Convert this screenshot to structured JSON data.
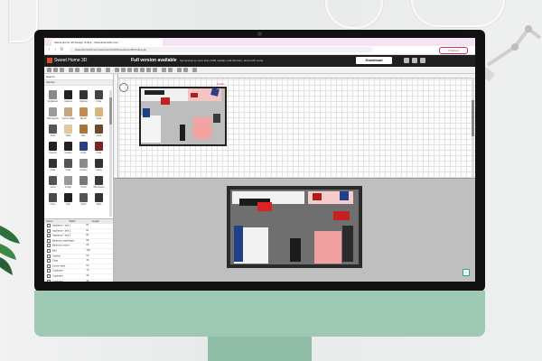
{
  "browser": {
    "tab_title": "Sweet Home 3D Design Online - SweetHome3D.com",
    "url": "sweethome3d.com/sweethome3d/SweetHome3DOnline.jsp",
    "profile_label": "Finished"
  },
  "app": {
    "name": "Sweet Home 3D",
    "banner_title": "Full version available",
    "banner_text": "Get access to more than 1400 models, edit furniture, and much more!",
    "download_label": "Download"
  },
  "catalog": {
    "search_label": "Search",
    "category": "Kitchen",
    "items": [
      {
        "label": "Appliance",
        "color": "#8a8a8a"
      },
      {
        "label": "Cabinet",
        "color": "#222222"
      },
      {
        "label": "Cabinet",
        "color": "#333333"
      },
      {
        "label": "Chair",
        "color": "#444444"
      },
      {
        "label": "Dishwasher",
        "color": "#9b9b9b"
      },
      {
        "label": "Corner table",
        "color": "#c9a77a"
      },
      {
        "label": "Bench",
        "color": "#c38b4f"
      },
      {
        "label": "Desk",
        "color": "#d9b57e"
      },
      {
        "label": "Shelf",
        "color": "#555555"
      },
      {
        "label": "Table",
        "color": "#e0c89a"
      },
      {
        "label": "Box",
        "color": "#a9743a"
      },
      {
        "label": "Desk",
        "color": "#6b4a2c"
      },
      {
        "label": "Counter",
        "color": "#222222"
      },
      {
        "label": "Cooker",
        "color": "#222222"
      },
      {
        "label": "Chair",
        "color": "#2b3e83"
      },
      {
        "label": "Chair",
        "color": "#7a2323"
      },
      {
        "label": "Chair",
        "color": "#333333"
      },
      {
        "label": "Chair",
        "color": "#555555"
      },
      {
        "label": "Cooker",
        "color": "#8a8a8a"
      },
      {
        "label": "Lamp",
        "color": "#333333"
      },
      {
        "label": "Lamp",
        "color": "#555555"
      },
      {
        "label": "Fridge",
        "color": "#999999"
      },
      {
        "label": "Hood",
        "color": "#777777"
      },
      {
        "label": "Microwave",
        "color": "#3a3a3a"
      },
      {
        "label": "Oven",
        "color": "#4a4a4a"
      },
      {
        "label": "Sink",
        "color": "#222222"
      },
      {
        "label": "Stool",
        "color": "#555555"
      },
      {
        "label": "Table",
        "color": "#333333"
      }
    ]
  },
  "furniture_table": {
    "headers": [
      "Name",
      "Width",
      "Height"
    ],
    "rows": [
      {
        "name": "Appliance - bed 1",
        "w": "87",
        "h": ""
      },
      {
        "name": "Appliance - bed 2",
        "w": "61",
        "h": ""
      },
      {
        "name": "Appliance - bed 3",
        "w": "54",
        "h": ""
      },
      {
        "name": "Bathroom washbasin",
        "w": "58",
        "h": ""
      },
      {
        "name": "Bathroom mirror",
        "w": "60",
        "h": ""
      },
      {
        "name": "Bed",
        "w": "160",
        "h": ""
      },
      {
        "name": "Cabinet",
        "w": "60",
        "h": ""
      },
      {
        "name": "Chair",
        "w": "45",
        "h": ""
      },
      {
        "name": "Corner table",
        "w": "60",
        "h": ""
      },
      {
        "name": "Cupboard",
        "w": "79",
        "h": ""
      },
      {
        "name": "Cupboard",
        "w": "40",
        "h": ""
      },
      {
        "name": "Cupboard",
        "w": "40",
        "h": ""
      }
    ]
  },
  "plan": {
    "label": "Studio"
  },
  "colors": {
    "accent": "#d6512d",
    "monitor_chin": "#9ec9b4"
  }
}
